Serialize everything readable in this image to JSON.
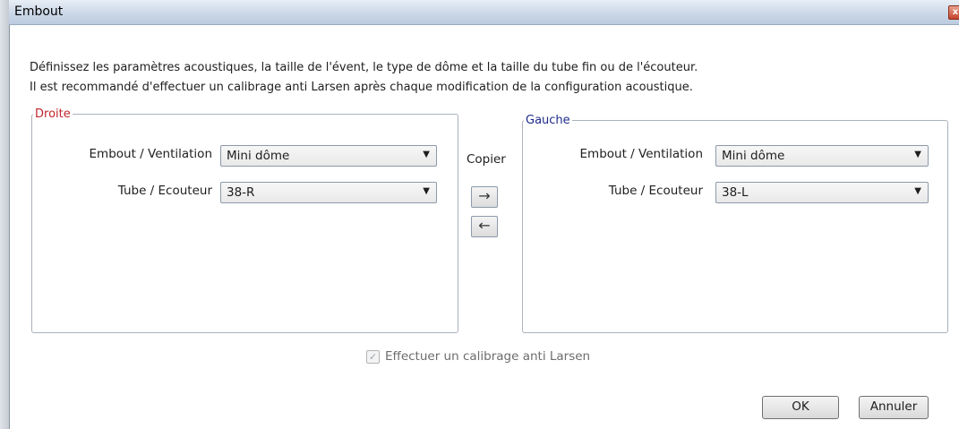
{
  "window": {
    "title": "Embout",
    "close_glyph": "x"
  },
  "description": {
    "line1": "Définissez les paramètres acoustiques, la taille de l'évent, le type de dôme et la taille du tube fin ou de l'écouteur.",
    "line2": "Il est recommandé d'effectuer un calibrage anti Larsen après chaque modification de la configuration acoustique."
  },
  "right_group": {
    "legend": "Droite",
    "color": "#c0252c",
    "embout_label": "Embout / Ventilation",
    "embout_value": "Mini dôme",
    "tube_label": "Tube / Ecouteur",
    "tube_value": "38-R"
  },
  "left_group": {
    "legend": "Gauche",
    "color": "#1f2a8c",
    "embout_label": "Embout / Ventilation",
    "embout_value": "Mini dôme",
    "tube_label": "Tube / Ecouteur",
    "tube_value": "38-L"
  },
  "copy": {
    "label": "Copier",
    "right_arrow": "→",
    "left_arrow": "←"
  },
  "calibration": {
    "label": "Effectuer un calibrage anti Larsen",
    "checked": true,
    "disabled": true
  },
  "buttons": {
    "ok": "OK",
    "cancel": "Annuler"
  },
  "dropdown_arrow": "▼",
  "checkmark": "✓"
}
